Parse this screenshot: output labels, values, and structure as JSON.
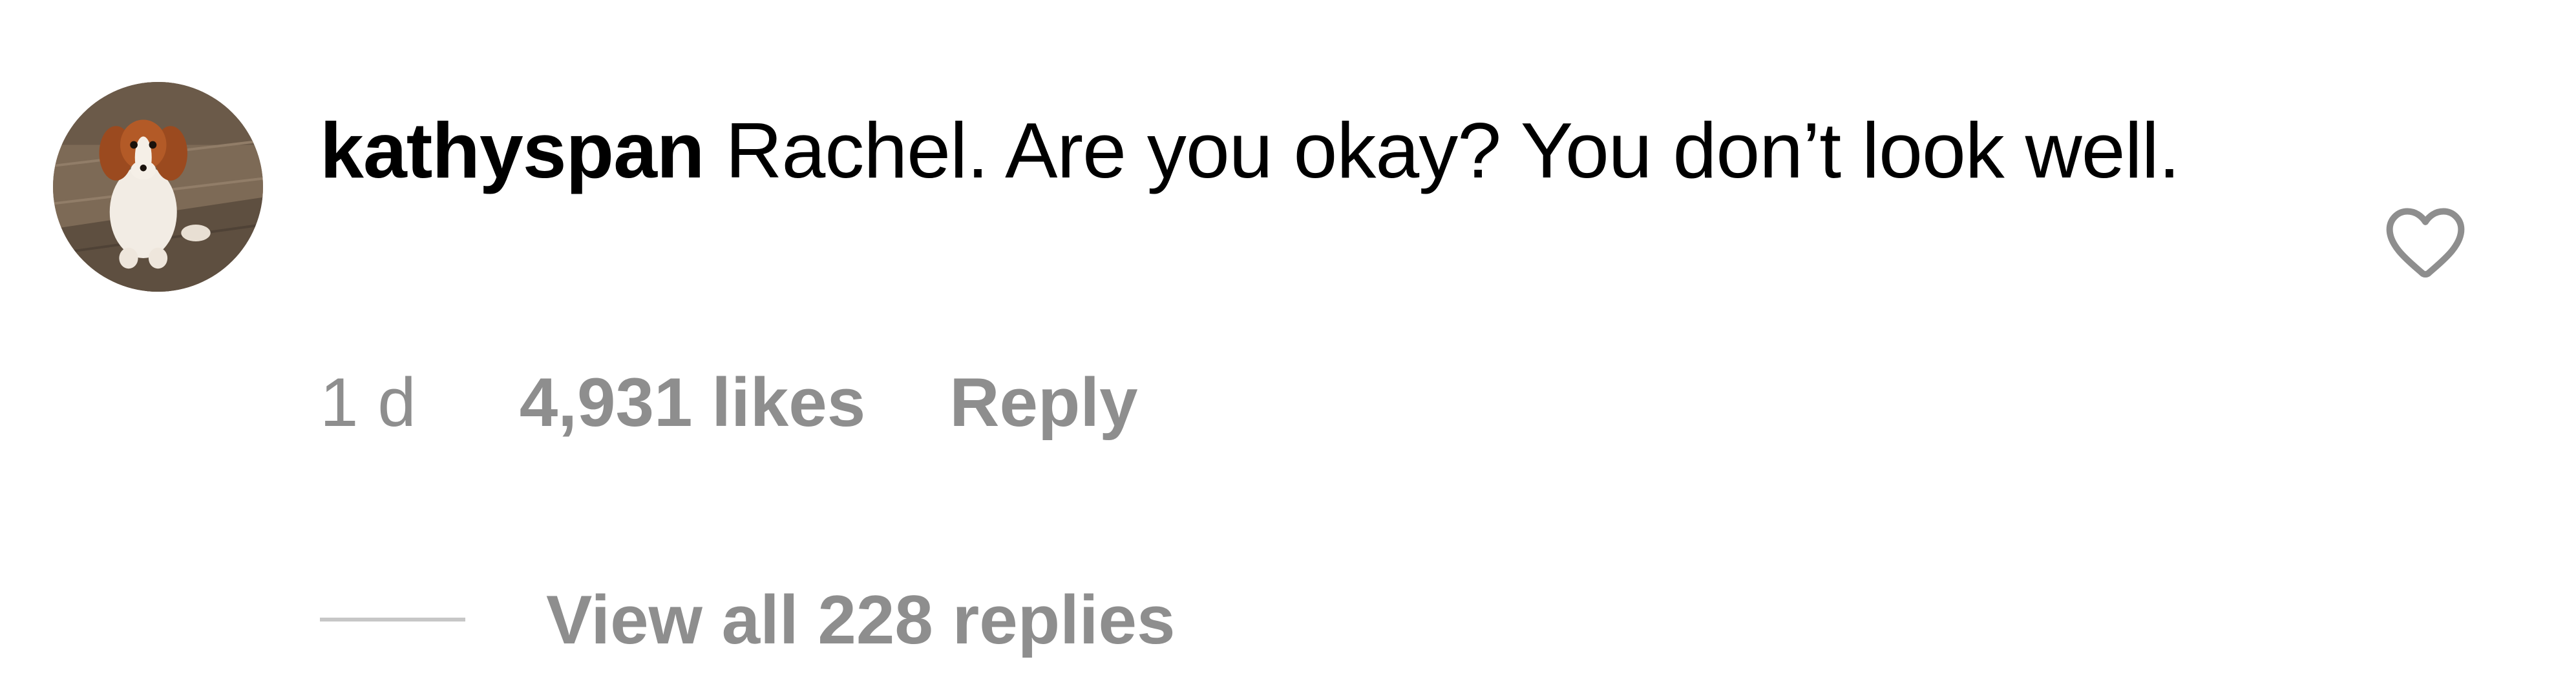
{
  "comment": {
    "username": "kathyspan",
    "text": "Rachel. Are you okay? You don’t look well.",
    "timestamp": "1 d",
    "likes": "4,931 likes",
    "reply_label": "Reply",
    "view_replies_label": "View all 228 replies",
    "like_icon": "heart-outline",
    "avatar_subject": "cavalier-king-charles-spaniel-photo"
  },
  "colors": {
    "text": "#000000",
    "secondary_text": "#8e8e8e",
    "divider": "#c7c7c7",
    "background": "#ffffff"
  }
}
